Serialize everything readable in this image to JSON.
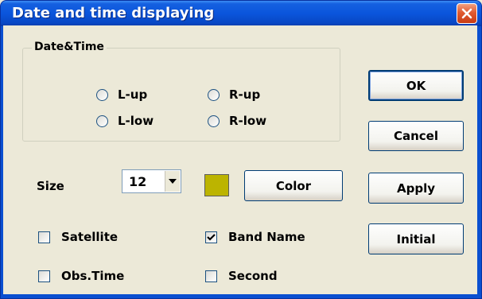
{
  "window": {
    "title": "Date and time displaying"
  },
  "group": {
    "label": "Date&Time",
    "options": [
      "L-up",
      "R-up",
      "L-low",
      "R-low"
    ]
  },
  "size": {
    "label": "Size",
    "value": "12"
  },
  "color": {
    "swatch": "#bcb400",
    "button_label": "Color"
  },
  "checkboxes": [
    {
      "label": "Satellite",
      "checked": false
    },
    {
      "label": "Band Name",
      "checked": true
    },
    {
      "label": "Obs.Time",
      "checked": false
    },
    {
      "label": "Second",
      "checked": false
    }
  ],
  "buttons": {
    "ok": "OK",
    "cancel": "Cancel",
    "apply": "Apply",
    "initial": "Initial"
  },
  "icons": {
    "close": "close-icon",
    "dropdown": "chevron-down-icon",
    "check": "checkmark-icon"
  }
}
